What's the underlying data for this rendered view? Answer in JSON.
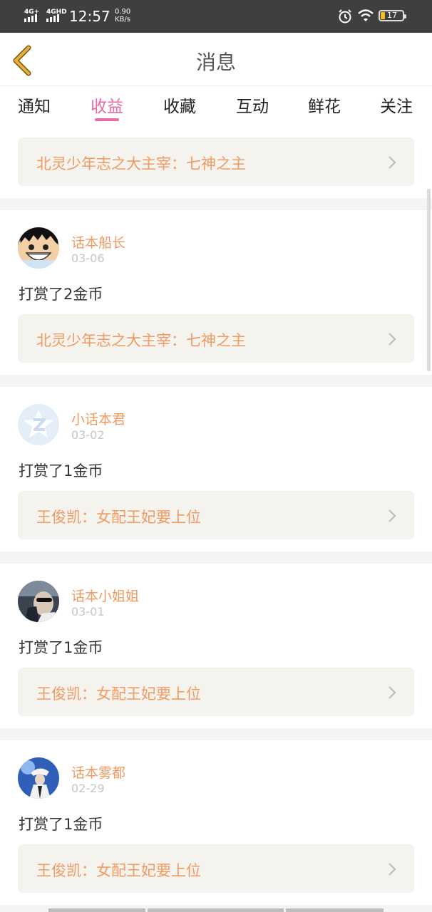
{
  "status_bar": {
    "signal1": "4G+",
    "signal2": "4GHD",
    "time": "12:57",
    "speed_value": "0.90",
    "speed_unit": "KB/s",
    "battery": "17"
  },
  "header": {
    "title": "消息",
    "back_icon": "chevron-left-icon"
  },
  "tabs": [
    {
      "label": "通知",
      "active": false
    },
    {
      "label": "收益",
      "active": true
    },
    {
      "label": "收藏",
      "active": false
    },
    {
      "label": "互动",
      "active": false
    },
    {
      "label": "鲜花",
      "active": false
    },
    {
      "label": "关注",
      "active": false
    }
  ],
  "top_item": {
    "book": "北灵少年志之大主宰：七神之主"
  },
  "items": [
    {
      "user": "话本船长",
      "date": "03-06",
      "action": "打赏了2金币",
      "book": "北灵少年志之大主宰：七神之主"
    },
    {
      "user": "小话本君",
      "date": "03-02",
      "action": "打赏了1金币",
      "book": "王俊凯：女配王妃要上位"
    },
    {
      "user": "话本小姐姐",
      "date": "03-01",
      "action": "打赏了1金币",
      "book": "王俊凯：女配王妃要上位"
    },
    {
      "user": "话本雾都",
      "date": "02-29",
      "action": "打赏了1金币",
      "book": "王俊凯：女配王妃要上位"
    }
  ],
  "colors": {
    "accent": "#e86aa6",
    "link_text": "#f09a63",
    "card_bg": "#f5f3ed",
    "back_arrow": "#e7b23a"
  }
}
